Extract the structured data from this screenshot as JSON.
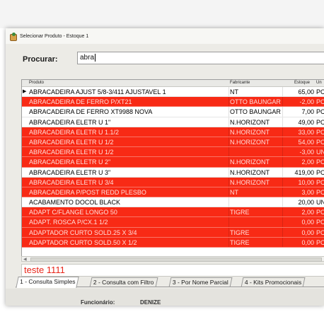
{
  "window": {
    "title": "Selecionar Produto - Estoque 1"
  },
  "search": {
    "label": "Procurar:",
    "value": "abra"
  },
  "table": {
    "headers": {
      "produto": "Produto",
      "fabricante": "Fabricante",
      "estoque": "Estoque",
      "un": "Un"
    },
    "rows": [
      {
        "produto": "ABRACADEIRA AJUST 5/8-3/411 AJUSTAVEL 1",
        "fabricante": "NT",
        "estoque": "65,00",
        "un": "PC",
        "status": "white",
        "current": true
      },
      {
        "produto": "ABRACADEIRA DE FERRO P/XT21",
        "fabricante": "OTTO BAUNGAR",
        "estoque": "-2,00",
        "un": "PC",
        "status": "red"
      },
      {
        "produto": "ABRACADEIRA DE FERRO XT9988 NOVA",
        "fabricante": "OTTO BAUNGAR",
        "estoque": "7,00",
        "un": "PC",
        "status": "white"
      },
      {
        "produto": "ABRACADEIRA ELETR U 1\"",
        "fabricante": "N.HORIZONT",
        "estoque": "49,00",
        "un": "PC",
        "status": "white"
      },
      {
        "produto": "ABRACADEIRA ELETR U 1.1/2",
        "fabricante": "N.HORIZONT",
        "estoque": "33,00",
        "un": "PC",
        "status": "red"
      },
      {
        "produto": "ABRACADEIRA ELETR U 1/2",
        "fabricante": "N.HORIZONT",
        "estoque": "54,00",
        "un": "PC",
        "status": "red"
      },
      {
        "produto": "ABRACADEIRA ELETR U 1/2",
        "fabricante": "",
        "estoque": "-3,00",
        "un": "UN",
        "status": "red"
      },
      {
        "produto": "ABRACADEIRA ELETR U 2\"",
        "fabricante": "N.HORIZONT",
        "estoque": "2,00",
        "un": "PC",
        "status": "red"
      },
      {
        "produto": "ABRACADEIRA ELETR U 3\"",
        "fabricante": "N.HORIZONT",
        "estoque": "419,00",
        "un": "PC",
        "status": "white"
      },
      {
        "produto": "ABRACADEIRA ELETR U 3/4",
        "fabricante": "N.HORIZONT",
        "estoque": "10,00",
        "un": "PC",
        "status": "red"
      },
      {
        "produto": "ABRACADEIRA P/POST REDD PLESBO",
        "fabricante": "NT",
        "estoque": "3,00",
        "un": "PC",
        "status": "red"
      },
      {
        "produto": "ACABAMENTO DOCOL BLACK",
        "fabricante": "",
        "estoque": "20,00",
        "un": "UN",
        "status": "white"
      },
      {
        "produto": "ADAPT C/FLANGE LONGO 50",
        "fabricante": "TIGRE",
        "estoque": "2,00",
        "un": "PC",
        "status": "red"
      },
      {
        "produto": "ADAPT. ROSCA P/CX.1 1/2",
        "fabricante": "",
        "estoque": "0,00",
        "un": "PC",
        "status": "red"
      },
      {
        "produto": "ADAPTADOR CURTO SOLD.25 X 3/4",
        "fabricante": "TIGRE",
        "estoque": "0,00",
        "un": "PC",
        "status": "red"
      },
      {
        "produto": "ADAPTADOR CURTO SOLD.50 X 1/2",
        "fabricante": "TIGRE",
        "estoque": "0,00",
        "un": "PC",
        "status": "red"
      }
    ]
  },
  "note": {
    "text": "teste 1111"
  },
  "tabs": [
    {
      "label": "1 - Consulta Simples",
      "active": true
    },
    {
      "label": "2 - Consulta com Filtro",
      "active": false
    },
    {
      "label": "3 - Por Nome Parcial",
      "active": false
    },
    {
      "label": "4 - Kits Promocionais",
      "active": false
    }
  ],
  "footer": {
    "funcionario_label": "Funcionário:",
    "funcionario_value": "DENIZE"
  },
  "colors": {
    "stock_alert": "#f82a15",
    "note_text": "#e8261a"
  }
}
